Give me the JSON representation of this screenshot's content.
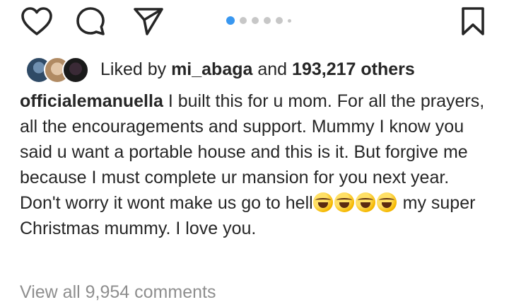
{
  "colors": {
    "text": "#262626",
    "muted": "#8e8e8e",
    "carousel_active": "#3897f0",
    "carousel_inactive": "#c7c7c7"
  },
  "actions": {
    "like_icon": "heart-outline",
    "comment_icon": "speech-bubble",
    "share_icon": "paper-plane",
    "save_icon": "bookmark-outline"
  },
  "carousel": {
    "total": 6,
    "active_index": 0
  },
  "likes": {
    "prefix": "Liked by",
    "user": "mi_abaga",
    "joiner": "and",
    "count": "193,217 others"
  },
  "caption": {
    "username": "officialemanuella",
    "text_part1": "I built this for u mom. For all the prayers, all the encouragements and support. Mummy I know you said u want a portable house and this is it. But forgive me because I must complete ur mansion for you next year. Don't worry it wont make us go to hell",
    "emoji_name": "rolling-on-floor-laughing",
    "emoji_count": 4,
    "text_part2": " my super Christmas mummy. I love you."
  },
  "comments": {
    "view_all_label": "View all 9,954 comments"
  }
}
